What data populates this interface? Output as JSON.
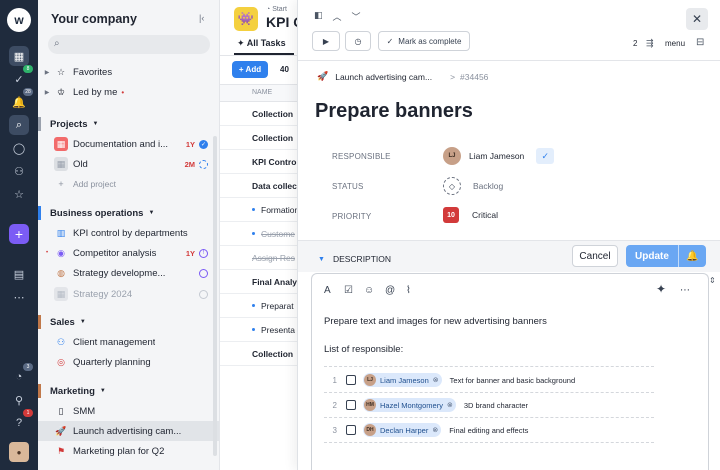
{
  "rail": {
    "logo": "w",
    "badges": {
      "inbox": "8",
      "notifications": "28",
      "alerts": "3",
      "help": "1"
    }
  },
  "sidebar": {
    "title": "Your company",
    "search_placeholder": "",
    "top": [
      {
        "label": "Favorites"
      },
      {
        "label": "Led by me"
      }
    ],
    "projects": {
      "header": "Projects",
      "items": [
        {
          "label": "Documentation and i...",
          "tag": "1Y"
        },
        {
          "label": "Old",
          "tag": "2M"
        }
      ],
      "add": "Add project"
    },
    "business": {
      "header": "Business operations",
      "items": [
        {
          "label": "KPI control by departments"
        },
        {
          "label": "Competitor analysis",
          "tag": "1Y"
        },
        {
          "label": "Strategy developme..."
        },
        {
          "label": "Strategy 2024"
        }
      ]
    },
    "sales": {
      "header": "Sales",
      "items": [
        {
          "label": "Client management"
        },
        {
          "label": "Quarterly planning"
        }
      ]
    },
    "marketing": {
      "header": "Marketing",
      "items": [
        {
          "label": "SMM"
        },
        {
          "label": "Launch advertising cam..."
        },
        {
          "label": "Marketing plan for Q2"
        }
      ]
    }
  },
  "center": {
    "start_label": "Start",
    "title": "KPI C",
    "tab": "All Tasks",
    "add_label": "Add",
    "count": "40",
    "column": "NAME",
    "rows": [
      {
        "text": "Collection",
        "bold": true
      },
      {
        "text": "Collection",
        "bold": true
      },
      {
        "text": "KPI Contro",
        "bold": true
      },
      {
        "text": "Data collec",
        "bold": true
      },
      {
        "text": "Formation",
        "bold": false,
        "sub": true
      },
      {
        "text": "Custome",
        "bold": false,
        "sub": true,
        "strike": true
      },
      {
        "text": "Assign Res",
        "bold": false,
        "strike": true
      },
      {
        "text": "Final Analy",
        "bold": true
      },
      {
        "text": "Preparat",
        "bold": false,
        "sub": true
      },
      {
        "text": "Presenta",
        "bold": false,
        "sub": true
      },
      {
        "text": "Collection",
        "bold": true
      }
    ]
  },
  "detail": {
    "mark_complete": "Mark as complete",
    "subtask_count": "2",
    "menu": "menu",
    "breadcrumb_parent": "Launch advertising cam...",
    "task_id": "#34456",
    "title": "Prepare banners",
    "fields": {
      "responsible_label": "RESPONSIBLE",
      "responsible_value": "Liam Jameson",
      "status_label": "STATUS",
      "status_value": "Backlog",
      "priority_label": "PRIORITY",
      "priority_number": "10",
      "priority_value": "Critical"
    },
    "description_label": "DESCRIPTION",
    "cancel": "Cancel",
    "update": "Update",
    "editor": {
      "line1": "Prepare text and images for new advertising banners",
      "line2": "List of responsible:",
      "tasks": [
        {
          "num": "1",
          "person": "Liam Jameson",
          "initials": "LJ",
          "desc": "Text for banner and basic background"
        },
        {
          "num": "2",
          "person": "Hazel Montgomery",
          "initials": "HM",
          "desc": "3D brand character"
        },
        {
          "num": "3",
          "person": "Declan Harper",
          "initials": "DH",
          "desc": "Final editing and effects"
        }
      ]
    }
  },
  "colors": {
    "accent": "#2f80ed",
    "rail": "#1f2b3d",
    "critical": "#d23a3a",
    "update_button": "#6aa7f3"
  }
}
